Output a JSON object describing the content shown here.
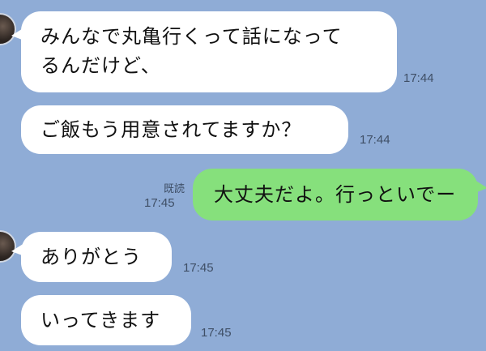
{
  "messages": [
    {
      "direction": "incoming",
      "text": "みんなで丸亀行くって話になって\nるんだけど、",
      "time": "17:44"
    },
    {
      "direction": "incoming",
      "text": "ご飯もう用意されてますか？",
      "time": "17:44"
    },
    {
      "direction": "outgoing",
      "text": "大丈夫だよ。行っといでー",
      "time": "17:45",
      "read_label": "既読"
    },
    {
      "direction": "incoming",
      "text": "ありがとう",
      "time": "17:45"
    },
    {
      "direction": "incoming",
      "text": "いってきます",
      "time": "17:45"
    }
  ],
  "colors": {
    "background": "#8facd6",
    "incoming_bubble": "#ffffff",
    "outgoing_bubble": "#86e07c",
    "meta_text": "#3f4f66"
  }
}
